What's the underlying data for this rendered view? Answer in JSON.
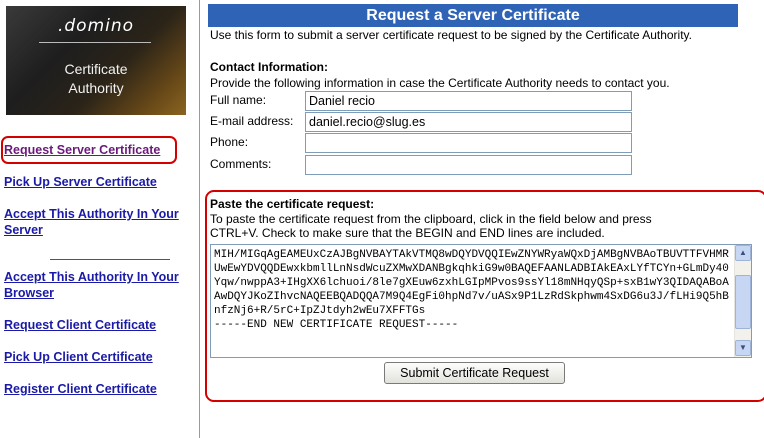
{
  "logo": {
    "brand": ".domino",
    "title_line1": "Certificate",
    "title_line2": "Authority"
  },
  "nav": {
    "request_server_cert": "Request Server Certificate",
    "pickup_server_cert": "Pick Up Server Certificate",
    "accept_authority_server": "Accept This Authority In Your Server",
    "accept_authority_browser": "Accept This Authority In Your Browser",
    "request_client_cert": "Request Client Certificate",
    "pickup_client_cert": "Pick Up Client Certificate",
    "register_client_cert": "Register Client Certificate"
  },
  "main": {
    "title": "Request a Server Certificate",
    "intro": "Use this form to submit a server certificate request to be signed by the Certificate Authority.",
    "contact_heading": "Contact Information:",
    "contact_desc": "Provide the following information in case the Certificate Authority needs to contact you.",
    "fields": {
      "full_name": {
        "label": "Full name:",
        "value": "Daniel recio"
      },
      "email": {
        "label": "E-mail address:",
        "value": "daniel.recio@slug.es"
      },
      "phone": {
        "label": "Phone:",
        "value": ""
      },
      "comments": {
        "label": "Comments:",
        "value": ""
      }
    },
    "paste_heading": "Paste the certificate request:",
    "paste_desc": "To paste the certificate request from the clipboard, click in the field below and press CTRL+V. Check to make sure that the BEGIN and END lines are included.",
    "cert_text": "MIH/MIGqAgEAMEUxCzAJBgNVBAYTAkVTMQ8wDQYDVQQIEwZNYWRyaWQxDjAMBgNVBAoTBUVTTFVHMRUwEwYDVQQDEwxkbmllLnNsdWcuZXMwXDANBgkqhkiG9w0BAQEFAANLADBIAkEAxLYfTCYn+GLmDy40Yqw/nwppA3+IHgXX6lchuoi/8le7gXEuw6zxhLGIpMPvos9ssYl18mNHqyQSp+sxB1wY3QIDAQABoAAwDQYJKoZIhvcNAQEEBQADQQA7M9Q4EgFi0hpNd7v/uASx9P1LzRdSkphwm4SxDG6u3J/fLHi9Q5hBnfzNj6+R/5rC+IpZJtdyh2wEu7XFFTGs\n-----END NEW CERTIFICATE REQUEST-----",
    "submit_label": "Submit Certificate Request"
  }
}
